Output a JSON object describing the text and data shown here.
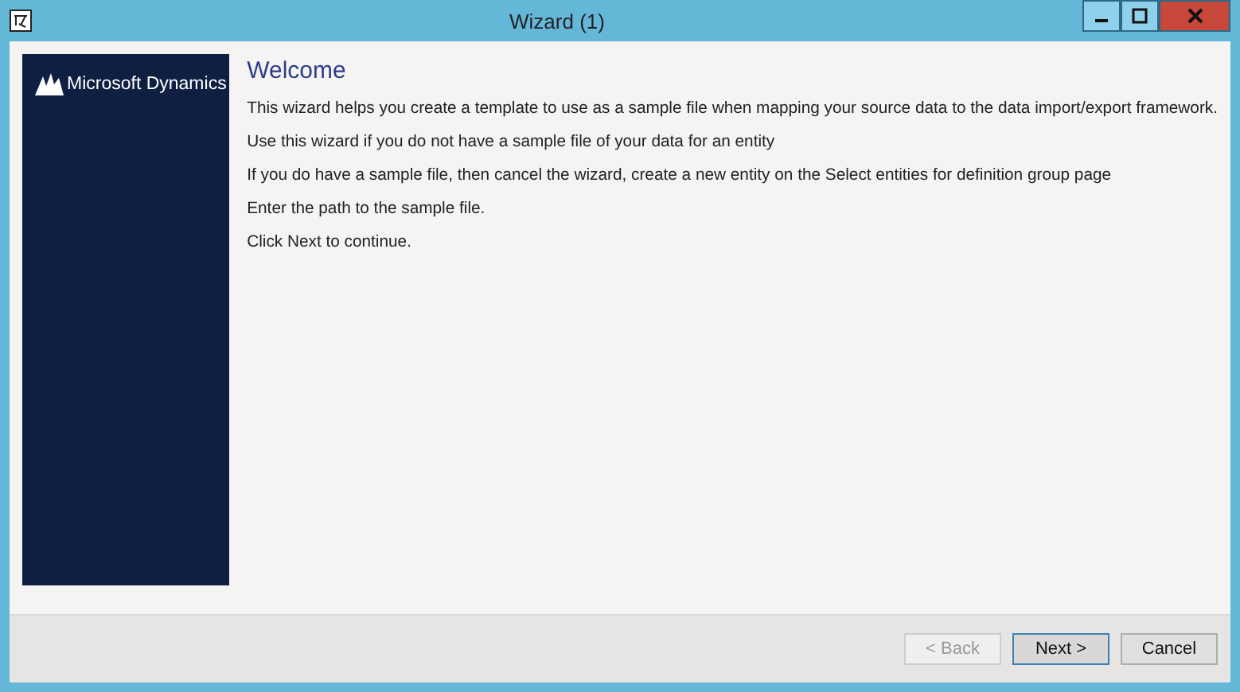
{
  "window": {
    "title": "Wizard (1)"
  },
  "sidebar": {
    "brand": "Microsoft Dynamics"
  },
  "heading": "Welcome",
  "paragraphs": [
    "This wizard helps you create a template to use as a sample file when mapping your source data to the data import/export framework.",
    "Use this wizard if you do not have a sample file of your data for an entity",
    "If you do have a sample file, then cancel the wizard, create a new entity on the Select entities for definition group page",
    "Enter the path to the sample file.",
    "Click Next to continue."
  ],
  "buttons": [
    {
      "label": "< Back",
      "disabled": true,
      "default": false
    },
    {
      "label": "Next >",
      "disabled": false,
      "default": true
    },
    {
      "label": "Cancel",
      "disabled": false,
      "default": false
    }
  ]
}
